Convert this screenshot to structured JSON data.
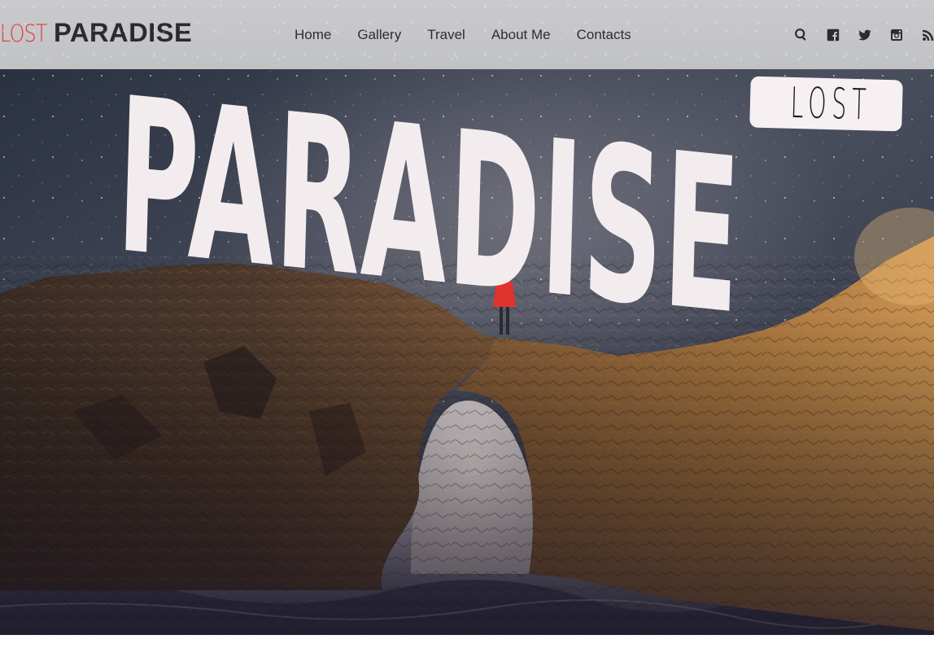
{
  "brand": {
    "logo_lost": "LOST",
    "logo_paradise": "PARADISE",
    "accent_color": "#e5343b",
    "dark_color": "#2b2b2e"
  },
  "nav": {
    "items": [
      {
        "label": "Home"
      },
      {
        "label": "Gallery"
      },
      {
        "label": "Travel"
      },
      {
        "label": "About Me"
      },
      {
        "label": "Contacts"
      }
    ]
  },
  "social_icons": [
    "search-icon",
    "facebook-icon",
    "twitter-icon",
    "instagram-icon",
    "rss-icon"
  ],
  "hero": {
    "title": "PARADISE",
    "badge": "LOST"
  }
}
